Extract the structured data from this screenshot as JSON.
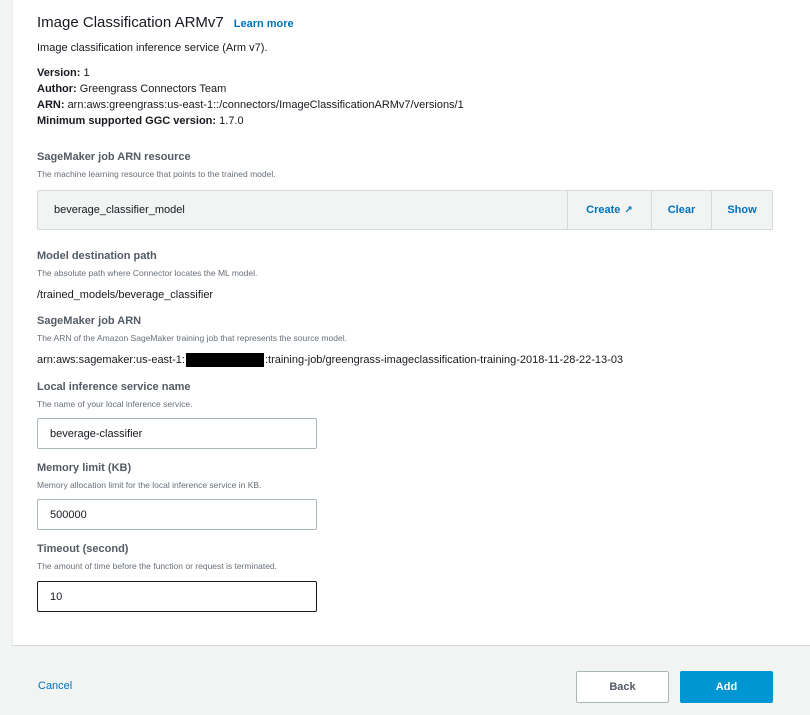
{
  "header": {
    "title": "Image Classification ARMv7",
    "learn_more": "Learn more",
    "description": "Image classification inference service (Arm v7)."
  },
  "meta": {
    "version_label": "Version:",
    "version_value": "1",
    "author_label": "Author:",
    "author_value": "Greengrass Connectors Team",
    "arn_label": "ARN:",
    "arn_value": "arn:aws:greengrass:us-east-1::/connectors/ImageClassificationARMv7/versions/1",
    "ggc_label": "Minimum supported GGC version:",
    "ggc_value": "1.7.0"
  },
  "sagemaker_resource": {
    "label": "SageMaker job ARN resource",
    "hint": "The machine learning resource that points to the trained model.",
    "value": "beverage_classifier_model",
    "create_label": "Create",
    "clear_label": "Clear",
    "show_label": "Show"
  },
  "model_path": {
    "label": "Model destination path",
    "hint": "The absolute path where Connector locates the ML model.",
    "value": "/trained_models/beverage_classifier"
  },
  "sagemaker_arn": {
    "label": "SageMaker job ARN",
    "hint": "The ARN of the Amazon SageMaker training job that represents the source model.",
    "value_prefix": "arn:aws:sagemaker:us-east-1:",
    "value_suffix": ":training-job/greengrass-imageclassification-training-2018-11-28-22-13-03"
  },
  "inference_name": {
    "label": "Local inference service name",
    "hint": "The name of your local inference service.",
    "value": "beverage-classifier"
  },
  "memory_limit": {
    "label": "Memory limit (KB)",
    "hint": "Memory allocation limit for the local inference service in KB.",
    "value": "500000"
  },
  "timeout": {
    "label": "Timeout (second)",
    "hint": "The amount of time before the function or request is terminated.",
    "value": "10"
  },
  "footer": {
    "cancel_label": "Cancel",
    "back_label": "Back",
    "add_label": "Add"
  },
  "colors": {
    "link": "#0073bb",
    "primary_button": "#0095d3"
  },
  "icons": {
    "create_external": "external-link-icon"
  }
}
